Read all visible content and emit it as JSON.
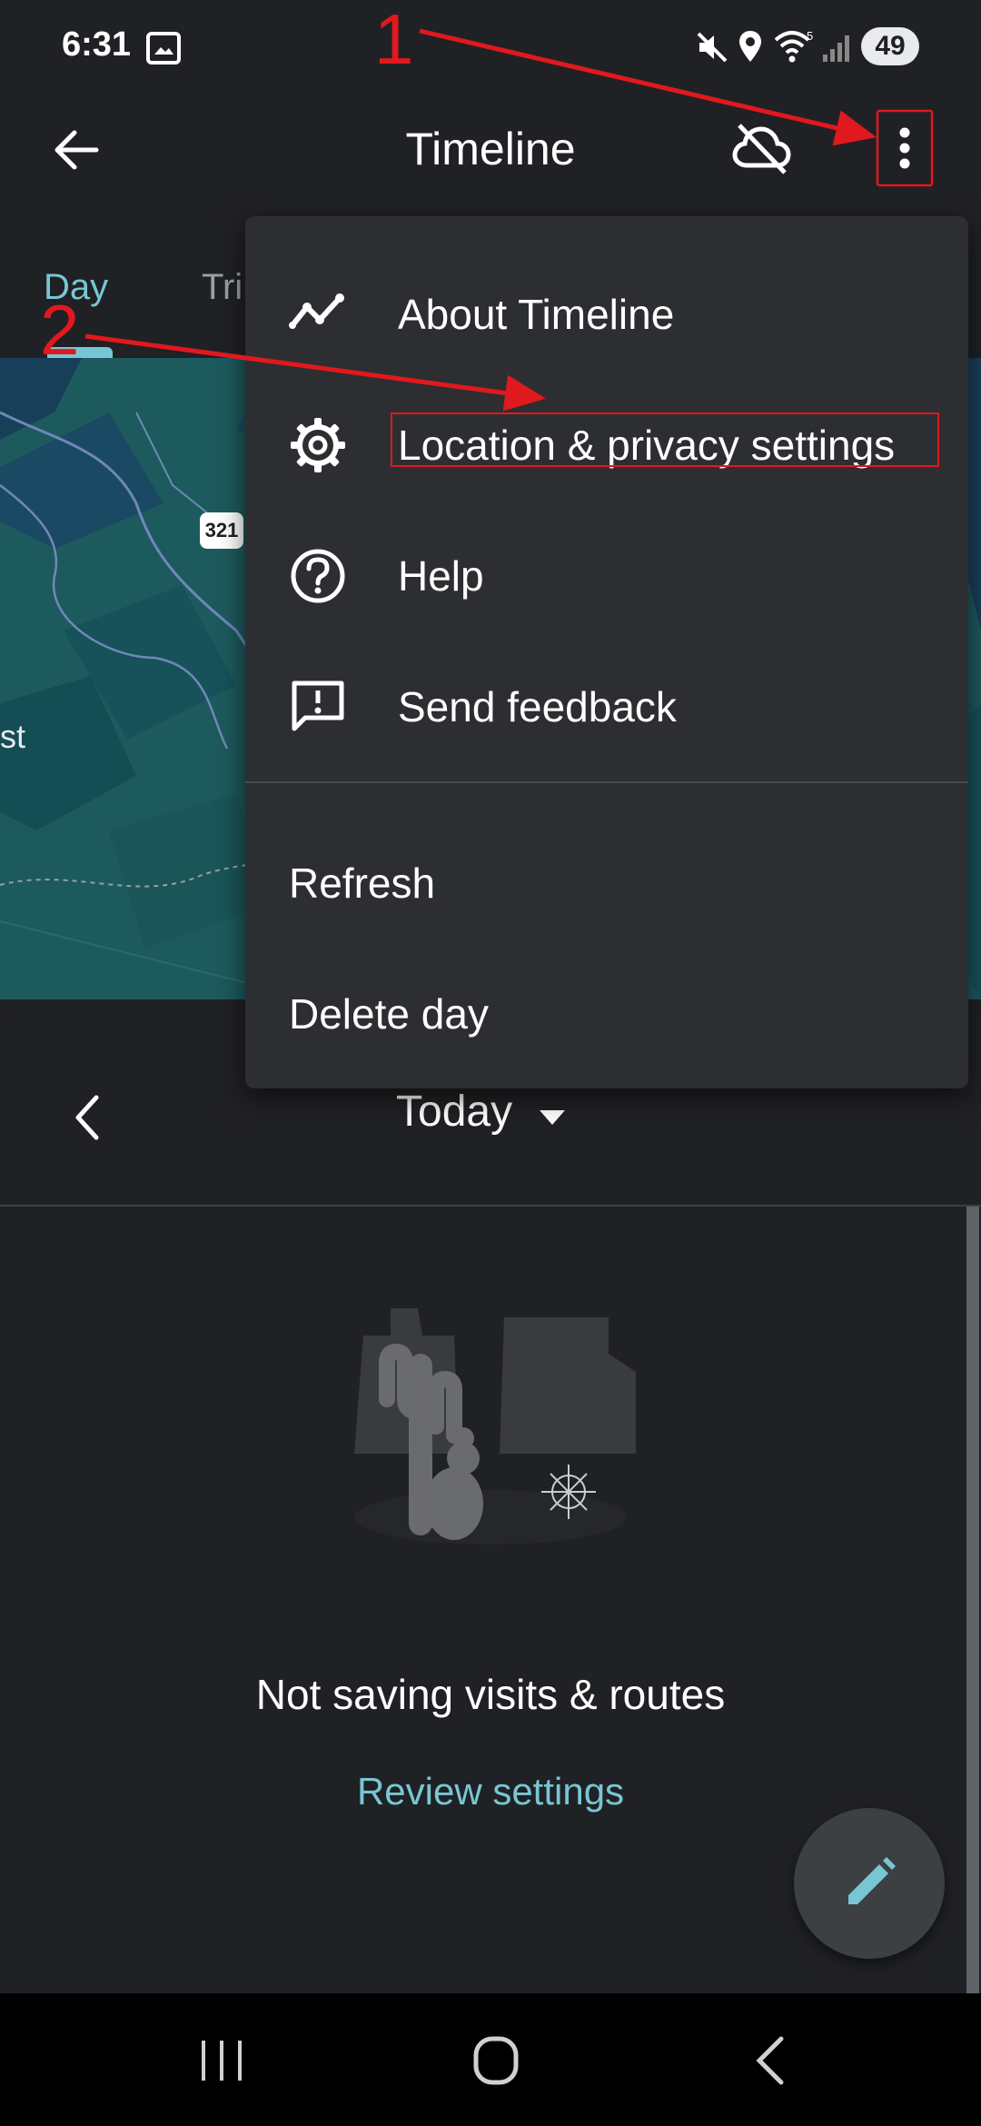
{
  "status_bar": {
    "time": "6:31",
    "battery": "49",
    "icons": [
      "screenshot-icon",
      "mute-icon",
      "location-icon",
      "wifi-icon",
      "signal-icon"
    ]
  },
  "app_bar": {
    "title": "Timeline",
    "icons": [
      "back-arrow-icon",
      "cloud-off-icon",
      "more-vert-icon"
    ]
  },
  "tabs": [
    {
      "label": "Day"
    },
    {
      "label": "Tri"
    }
  ],
  "map": {
    "route_shield": "321",
    "place_fragment": "st"
  },
  "menu": {
    "items": [
      {
        "label": "About Timeline",
        "icon": "timeline-icon"
      },
      {
        "label": "Location & privacy settings",
        "icon": "settings-gear-icon"
      },
      {
        "label": "Help",
        "icon": "help-icon"
      },
      {
        "label": "Send feedback",
        "icon": "feedback-icon"
      },
      {
        "label": "Refresh"
      },
      {
        "label": "Delete day"
      }
    ]
  },
  "date_nav": {
    "label": "Today"
  },
  "empty_state": {
    "message": "Not saving visits & routes",
    "action": "Review settings"
  },
  "annotations": {
    "step1": "1",
    "step2": "2"
  },
  "colors": {
    "background": "#202124",
    "accent": "#78c6d4",
    "menu_bg": "#2d2e31",
    "map": "#1e5b5e",
    "annotation_red": "#e0191f"
  }
}
